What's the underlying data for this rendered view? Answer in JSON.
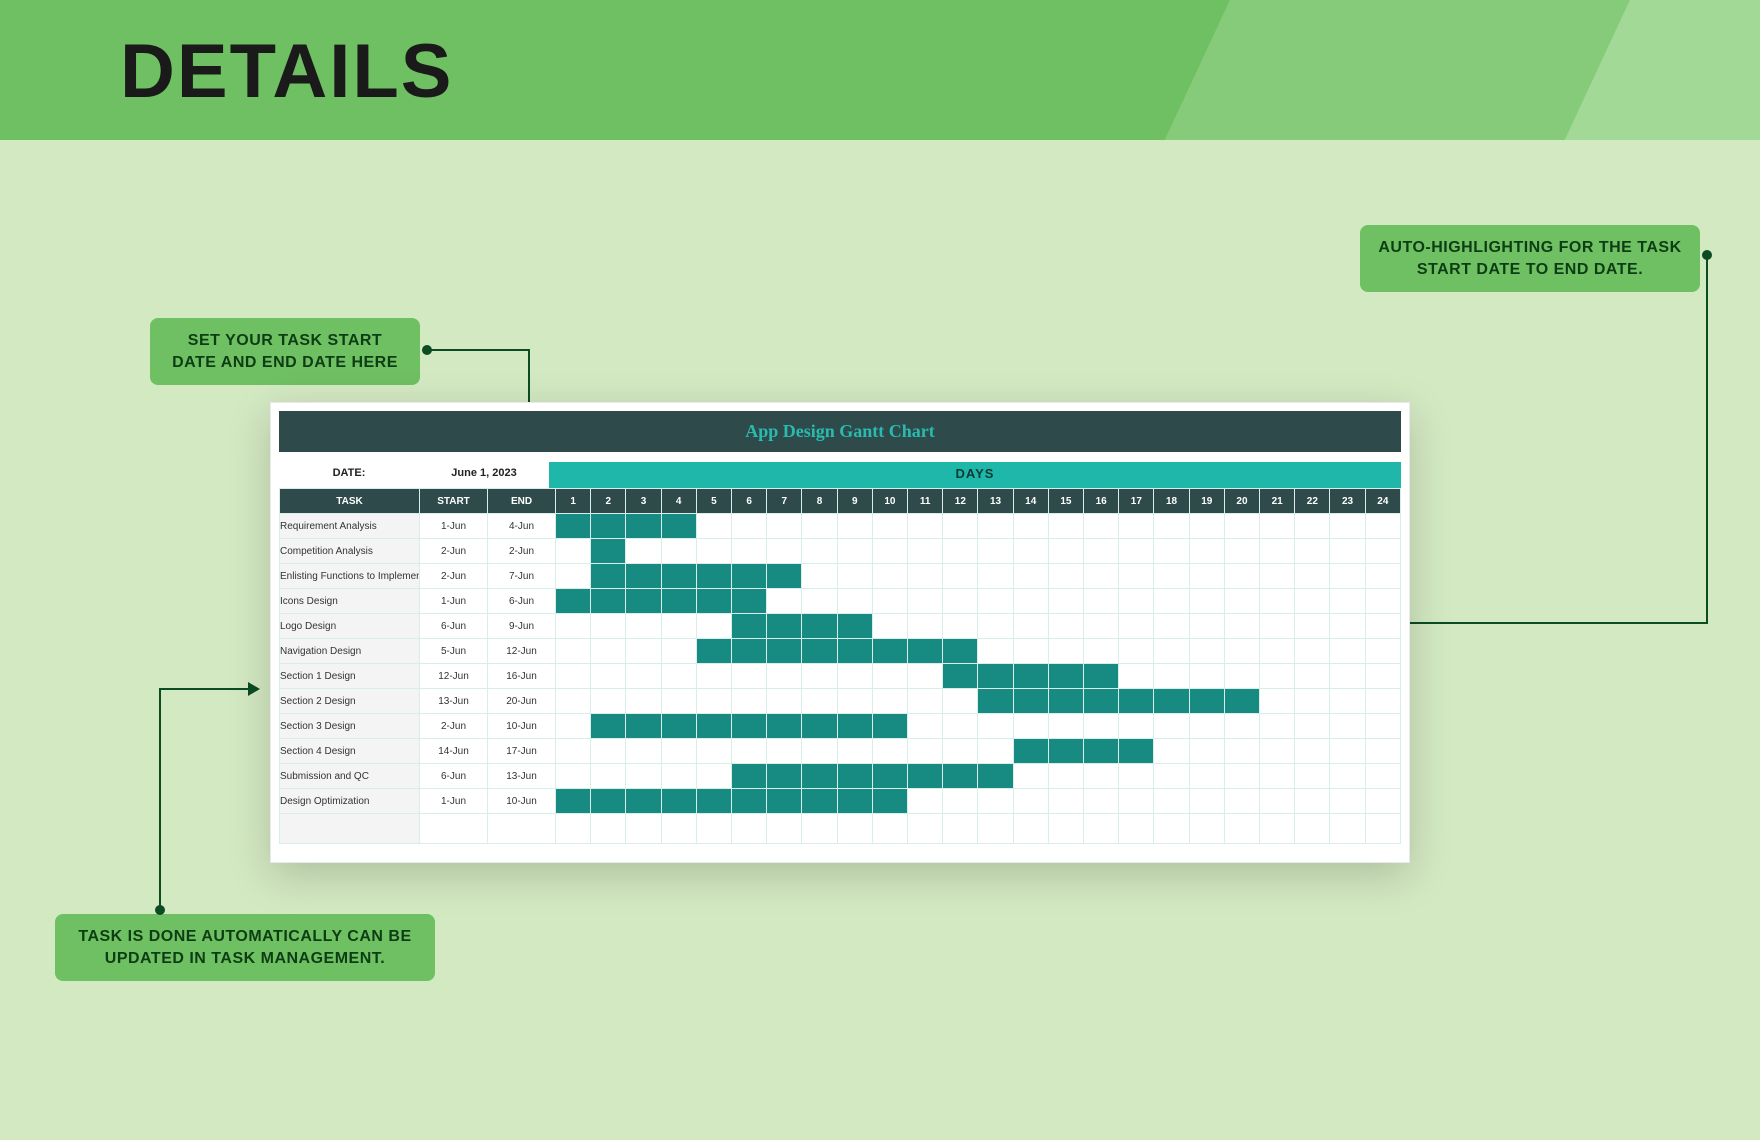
{
  "banner": {
    "title": "DETAILS"
  },
  "callouts": {
    "c1": "SET YOUR TASK START DATE AND END DATE HERE",
    "c2": "AUTO-HIGHLIGHTING FOR THE TASK START DATE TO END DATE.",
    "c3": "TASK IS DONE AUTOMATICALLY CAN BE UPDATED IN TASK MANAGEMENT."
  },
  "sheet": {
    "title": "App Design Gantt Chart",
    "date_label": "DATE:",
    "date_value": "June 1, 2023",
    "days_label": "DAYS",
    "headers": {
      "task": "TASK",
      "start": "START",
      "end": "END"
    }
  },
  "chart_data": {
    "type": "gantt",
    "title": "App Design Gantt Chart",
    "xlabel": "DAYS",
    "x_range": [
      1,
      24
    ],
    "month": "Jun",
    "tasks": [
      {
        "name": "Requirement Analysis",
        "start_day": 1,
        "end_day": 4,
        "start": "1-Jun",
        "end": "4-Jun"
      },
      {
        "name": "Competition Analysis",
        "start_day": 2,
        "end_day": 2,
        "start": "2-Jun",
        "end": "2-Jun"
      },
      {
        "name": "Enlisting Functions to Implemen",
        "start_day": 2,
        "end_day": 7,
        "start": "2-Jun",
        "end": "7-Jun"
      },
      {
        "name": "Icons Design",
        "start_day": 1,
        "end_day": 6,
        "start": "1-Jun",
        "end": "6-Jun"
      },
      {
        "name": "Logo Design",
        "start_day": 6,
        "end_day": 9,
        "start": "6-Jun",
        "end": "9-Jun"
      },
      {
        "name": "Navigation Design",
        "start_day": 5,
        "end_day": 12,
        "start": "5-Jun",
        "end": "12-Jun"
      },
      {
        "name": "Section 1 Design",
        "start_day": 12,
        "end_day": 16,
        "start": "12-Jun",
        "end": "16-Jun"
      },
      {
        "name": "Section 2 Design",
        "start_day": 13,
        "end_day": 20,
        "start": "13-Jun",
        "end": "20-Jun"
      },
      {
        "name": "Section 3 Design",
        "start_day": 2,
        "end_day": 10,
        "start": "2-Jun",
        "end": "10-Jun"
      },
      {
        "name": "Section 4 Design",
        "start_day": 14,
        "end_day": 17,
        "start": "14-Jun",
        "end": "17-Jun"
      },
      {
        "name": "Submission and QC",
        "start_day": 6,
        "end_day": 13,
        "start": "6-Jun",
        "end": "13-Jun"
      },
      {
        "name": "Design Optimization",
        "start_day": 1,
        "end_day": 10,
        "start": "1-Jun",
        "end": "10-Jun"
      }
    ]
  }
}
